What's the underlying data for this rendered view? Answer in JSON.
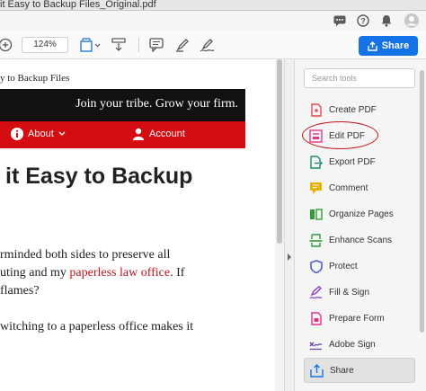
{
  "window": {
    "title": "it Easy to Backup Files_Original.pdf"
  },
  "toolbar": {
    "zoom_value": "124%",
    "share_label": "Share"
  },
  "document": {
    "header": "y to Backup Files",
    "tagline": "Join your tribe. Grow your firm.",
    "nav_about": "About",
    "nav_account": "Account",
    "headline": "it Easy to Backup",
    "para1_line1": "rminded both sides to preserve all",
    "para1_line2_before": "uting and my ",
    "para1_link": "paperless law office",
    "para1_line2_after": ". If",
    "para1_line3": "flames?",
    "para2_line1": "witching to a paperless office makes it"
  },
  "tools_pane": {
    "search_placeholder": "Search tools",
    "tools": [
      {
        "label": "Create PDF",
        "icon": "create-pdf-icon",
        "color": "#e34850"
      },
      {
        "label": "Edit PDF",
        "icon": "edit-pdf-icon",
        "color": "#e0398c"
      },
      {
        "label": "Export PDF",
        "icon": "export-pdf-icon",
        "color": "#1a8c7a"
      },
      {
        "label": "Comment",
        "icon": "comment-icon",
        "color": "#e8b100"
      },
      {
        "label": "Organize Pages",
        "icon": "organize-pages-icon",
        "color": "#2d9d36"
      },
      {
        "label": "Enhance Scans",
        "icon": "enhance-scans-icon",
        "color": "#2d9d36"
      },
      {
        "label": "Protect",
        "icon": "protect-icon",
        "color": "#4b55c8"
      },
      {
        "label": "Fill & Sign",
        "icon": "fill-sign-icon",
        "color": "#8c44c8"
      },
      {
        "label": "Prepare Form",
        "icon": "prepare-form-icon",
        "color": "#d9368c"
      },
      {
        "label": "Adobe Sign",
        "icon": "adobe-sign-icon",
        "color": "#6b3fb3"
      },
      {
        "label": "Share",
        "icon": "share-icon",
        "color": "#1473e6"
      }
    ]
  }
}
